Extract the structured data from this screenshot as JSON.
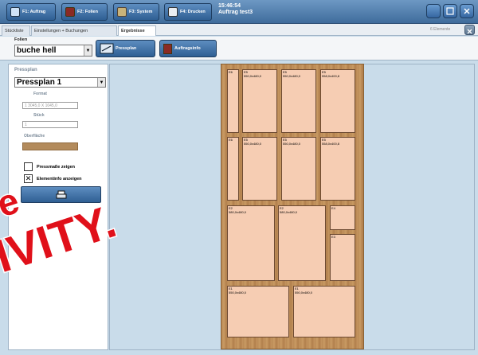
{
  "toolbar": {
    "buttons": [
      {
        "label": "F1: Auftrag",
        "icon": "folder-icon"
      },
      {
        "label": "F2: Folien",
        "icon": "book-icon"
      },
      {
        "label": "F3: System",
        "icon": "tools-icon"
      },
      {
        "label": "F4: Drucken",
        "icon": "printer-icon"
      }
    ],
    "clock_time": "15:46:54",
    "order_name": "Auftrag test3"
  },
  "tabs": [
    {
      "label": "Stückliste",
      "active": false
    },
    {
      "label": "Einstellungen + Buchungen",
      "active": false
    },
    {
      "label": "Ergebnisse",
      "active": true
    }
  ],
  "element_count": "6 Elemente",
  "folien": {
    "label": "Folien",
    "selected": "buche hell",
    "pressplan_button": "Pressplan",
    "auftragsinfo_button": "Auftragsinfo"
  },
  "left_panel": {
    "title": "Pressplan",
    "pressplan_selected": "Pressplan 1",
    "format_label": "Format",
    "format_value": "1 3045,0 X 1045,0",
    "stueck_label": "Stück",
    "stueck_value": "1",
    "surface_label": "Oberfläche",
    "surface_color": "#b38b5c",
    "check1_label": "Pressmaße zeigen",
    "check1_checked": false,
    "check2_label": "Elementinfo anzeigen",
    "check2_checked": true
  },
  "board": {
    "pieces": [
      {
        "id": "E6",
        "dims": ""
      },
      {
        "id": "E5",
        "dims": "550,0x480,0"
      },
      {
        "id": "E5",
        "dims": "550,0x480,0"
      },
      {
        "id": "E5",
        "dims": "558,0x400,8"
      },
      {
        "id": "E6",
        "dims": ""
      },
      {
        "id": "E5",
        "dims": "550,0x480,0"
      },
      {
        "id": "E5",
        "dims": "550,0x480,0"
      },
      {
        "id": "E5",
        "dims": "558,0x400,8"
      },
      {
        "id": "E2",
        "dims": "580,0x480,0"
      },
      {
        "id": "E2",
        "dims": "580,0x480,0"
      },
      {
        "id": "E4",
        "dims": ""
      },
      {
        "id": "E3",
        "dims": ""
      },
      {
        "id": "E1",
        "dims": "550,0x480,0"
      },
      {
        "id": "E1",
        "dims": "550,0x480,0"
      }
    ]
  },
  "watermark": {
    "line1": "re",
    "line2": "IVITY.",
    "color": "#e0101a"
  }
}
